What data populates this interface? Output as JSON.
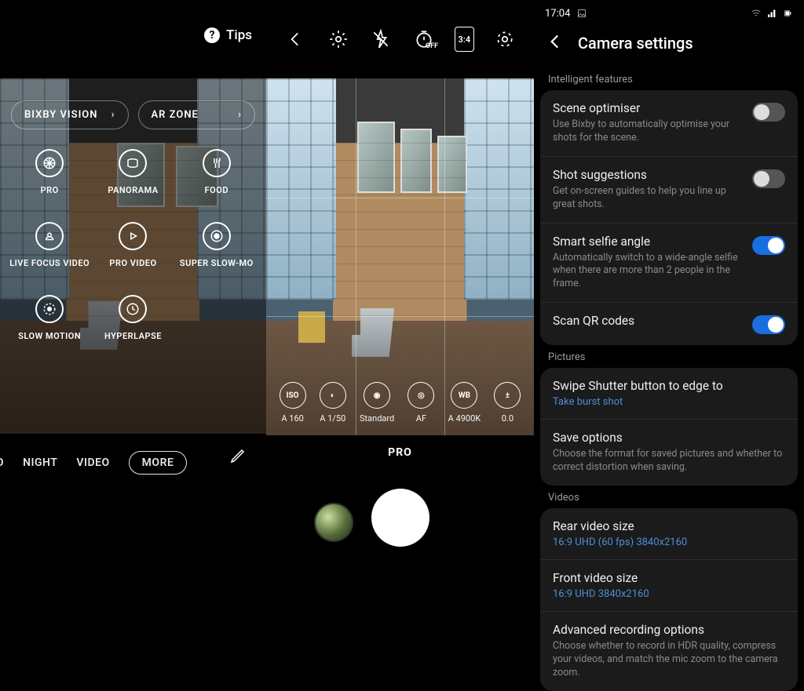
{
  "left": {
    "tips_label": "Tips",
    "pills": {
      "bixby": "BIXBY VISION",
      "ar": "AR ZONE"
    },
    "modes": [
      "PRO",
      "PANORAMA",
      "FOOD",
      "LIVE FOCUS VIDEO",
      "PRO VIDEO",
      "SUPER SLOW-MO",
      "SLOW MOTION",
      "HYPERLAPSE"
    ],
    "rail": {
      "to": "TO",
      "night": "NIGHT",
      "video": "VIDEO",
      "more": "MORE"
    }
  },
  "mid": {
    "timer_suffix": "OFF",
    "ratio": "3:4",
    "dials": {
      "iso": {
        "icon": "ISO",
        "label": "A 160"
      },
      "shutter": {
        "icon": "◐",
        "label": "A 1/50"
      },
      "tone": {
        "icon": "◉",
        "label": "Standard"
      },
      "focus": {
        "icon": "◎",
        "label": "AF"
      },
      "wb": {
        "icon": "WB",
        "label": "A 4900K"
      },
      "ev": {
        "icon": "±",
        "label": "0.0"
      }
    },
    "mode_label": "PRO"
  },
  "right": {
    "time": "17:04",
    "title": "Camera settings",
    "sections": {
      "intelligent": "Intelligent features",
      "pictures": "Pictures",
      "videos": "Videos"
    },
    "scene_opt": {
      "title": "Scene optimiser",
      "desc": "Use Bixby to automatically optimise your shots for the scene."
    },
    "shot_sugg": {
      "title": "Shot suggestions",
      "desc": "Get on-screen guides to help you line up great shots."
    },
    "selfie_ang": {
      "title": "Smart selfie angle",
      "desc": "Automatically switch to a wide-angle selfie when there are more than 2 people in the frame."
    },
    "scan_qr": {
      "title": "Scan QR codes"
    },
    "swipe_shut": {
      "title": "Swipe Shutter button to edge to",
      "link": "Take burst shot"
    },
    "save_opt": {
      "title": "Save options",
      "desc": "Choose the format for saved pictures and whether to correct distortion when saving."
    },
    "rear_vid": {
      "title": "Rear video size",
      "link": "16:9 UHD (60 fps) 3840x2160"
    },
    "front_vid": {
      "title": "Front video size",
      "link": "16:9 UHD 3840x2160"
    },
    "adv_rec": {
      "title": "Advanced recording options",
      "desc": "Choose whether to record in HDR quality, compress your videos, and match the mic zoom to the camera zoom."
    }
  }
}
